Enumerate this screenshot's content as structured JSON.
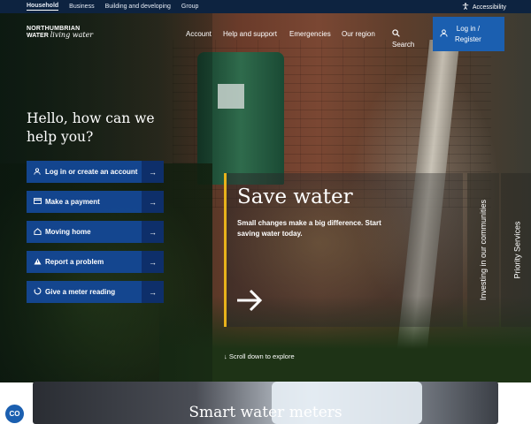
{
  "topbar": {
    "tabs": [
      "Household",
      "Business",
      "Building and developing",
      "Group"
    ],
    "accessibility": "Accessibility"
  },
  "header": {
    "logo_line1": "NORTHUMBRIAN",
    "logo_line2": "WATER",
    "logo_tagline": "living water",
    "nav": [
      "Account",
      "Help and support",
      "Emergencies",
      "Our region"
    ],
    "search": "Search",
    "login_line1": "Log in /",
    "login_line2": "Register"
  },
  "hero": {
    "greeting": "Hello, how can we help you?",
    "actions": [
      {
        "label": "Log in or create an account",
        "icon": "user-icon"
      },
      {
        "label": "Make a payment",
        "icon": "card-icon"
      },
      {
        "label": "Moving home",
        "icon": "home-icon"
      },
      {
        "label": "Report a problem",
        "icon": "warning-icon"
      },
      {
        "label": "Give a meter reading",
        "icon": "meter-icon"
      }
    ],
    "card_title": "Save water",
    "card_text": "Small changes make a big difference. Start saving water today.",
    "side_tabs": [
      "Investing in our communities",
      "Priority Services"
    ],
    "scroll_hint": "Scroll down to explore"
  },
  "bottom": {
    "title": "Smart water meters"
  },
  "cookie": "CO",
  "colors": {
    "accent": "#e8b21b",
    "button_blue": "#1b5fb0",
    "action_blue": "#14489a",
    "topbar": "#0d2340"
  }
}
